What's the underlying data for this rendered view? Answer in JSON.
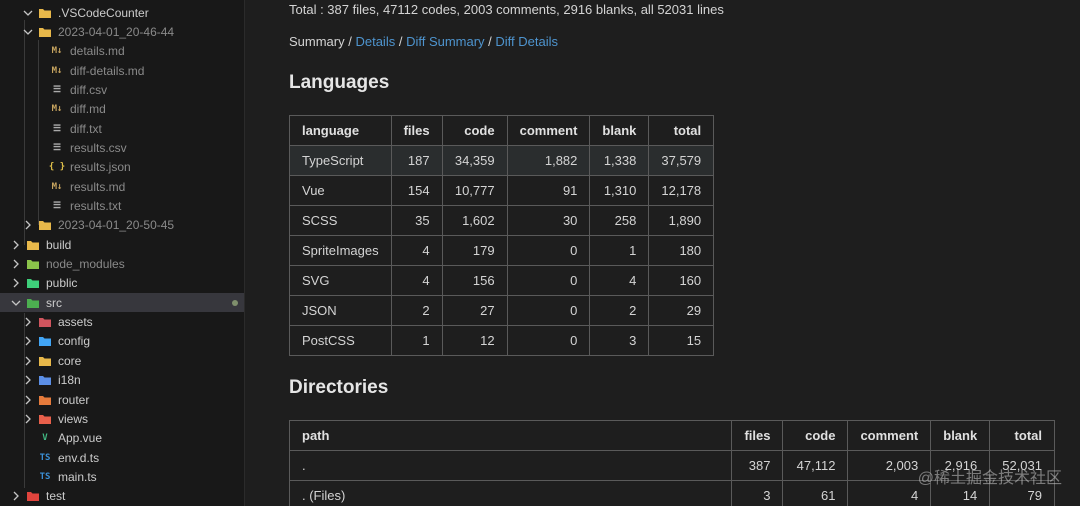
{
  "sidebar": {
    "items": [
      {
        "label": ".VSCodeCounter",
        "icon": "folder-icon",
        "chevron": "down"
      },
      {
        "label": "2023-04-01_20-46-44",
        "icon": "folder-open-icon",
        "chevron": "down"
      },
      {
        "label": "details.md",
        "icon": "markdown-icon"
      },
      {
        "label": "diff-details.md",
        "icon": "markdown-icon"
      },
      {
        "label": "diff.csv",
        "icon": "csv-file-icon"
      },
      {
        "label": "diff.md",
        "icon": "markdown-icon"
      },
      {
        "label": "diff.txt",
        "icon": "text-file-icon"
      },
      {
        "label": "results.csv",
        "icon": "csv-file-icon"
      },
      {
        "label": "results.json",
        "icon": "json-icon"
      },
      {
        "label": "results.md",
        "icon": "markdown-icon"
      },
      {
        "label": "results.txt",
        "icon": "text-file-icon"
      },
      {
        "label": "2023-04-01_20-50-45",
        "icon": "folder-icon",
        "chevron": "right"
      },
      {
        "label": "build",
        "icon": "folder-icon",
        "chevron": "right"
      },
      {
        "label": "node_modules",
        "icon": "node-folder-icon",
        "chevron": "right"
      },
      {
        "label": "public",
        "icon": "public-folder-icon",
        "chevron": "right"
      },
      {
        "label": "src",
        "icon": "src-folder-icon",
        "chevron": "down"
      },
      {
        "label": "assets",
        "icon": "assets-folder-icon",
        "chevron": "right"
      },
      {
        "label": "config",
        "icon": "config-folder-icon",
        "chevron": "right"
      },
      {
        "label": "core",
        "icon": "folder-icon",
        "chevron": "right"
      },
      {
        "label": "i18n",
        "icon": "i18n-folder-icon",
        "chevron": "right"
      },
      {
        "label": "router",
        "icon": "router-folder-icon",
        "chevron": "right"
      },
      {
        "label": "views",
        "icon": "views-folder-icon",
        "chevron": "right"
      },
      {
        "label": "App.vue",
        "icon": "vue-icon"
      },
      {
        "label": "env.d.ts",
        "icon": "typescript-icon"
      },
      {
        "label": "main.ts",
        "icon": "typescript-icon"
      },
      {
        "label": "test",
        "icon": "test-folder-icon",
        "chevron": "right"
      }
    ],
    "icon_glyphs": {
      "markdown": "M↓",
      "json": "{ }",
      "typescript": "TS",
      "vue": "V"
    }
  },
  "summary": {
    "total_line": "Total : 387 files, 47112 codes, 2003 comments, 2916 blanks, all 52031 lines",
    "nav_summary": "Summary",
    "nav_sep": " / ",
    "nav_details": "Details",
    "nav_diff_summary": "Diff Summary",
    "nav_diff_details": "Diff Details"
  },
  "languages": {
    "title": "Languages",
    "headers": [
      "language",
      "files",
      "code",
      "comment",
      "blank",
      "total"
    ],
    "rows": [
      [
        "TypeScript",
        "187",
        "34,359",
        "1,882",
        "1,338",
        "37,579"
      ],
      [
        "Vue",
        "154",
        "10,777",
        "91",
        "1,310",
        "12,178"
      ],
      [
        "SCSS",
        "35",
        "1,602",
        "30",
        "258",
        "1,890"
      ],
      [
        "SpriteImages",
        "4",
        "179",
        "0",
        "1",
        "180"
      ],
      [
        "SVG",
        "4",
        "156",
        "0",
        "4",
        "160"
      ],
      [
        "JSON",
        "2",
        "27",
        "0",
        "2",
        "29"
      ],
      [
        "PostCSS",
        "1",
        "12",
        "0",
        "3",
        "15"
      ]
    ]
  },
  "directories": {
    "title": "Directories",
    "headers": [
      "path",
      "files",
      "code",
      "comment",
      "blank",
      "total"
    ],
    "rows": [
      [
        ".",
        "387",
        "47,112",
        "2,003",
        "2,916",
        "52,031"
      ],
      [
        ". (Files)",
        "3",
        "61",
        "4",
        "14",
        "79"
      ]
    ]
  },
  "watermark": "@稀土掘金技术社区",
  "colors": {
    "link": "#4e94ce",
    "background": "#1e1e1e",
    "sidebar": "#181818",
    "modified_dot": "#7f8f6c"
  }
}
